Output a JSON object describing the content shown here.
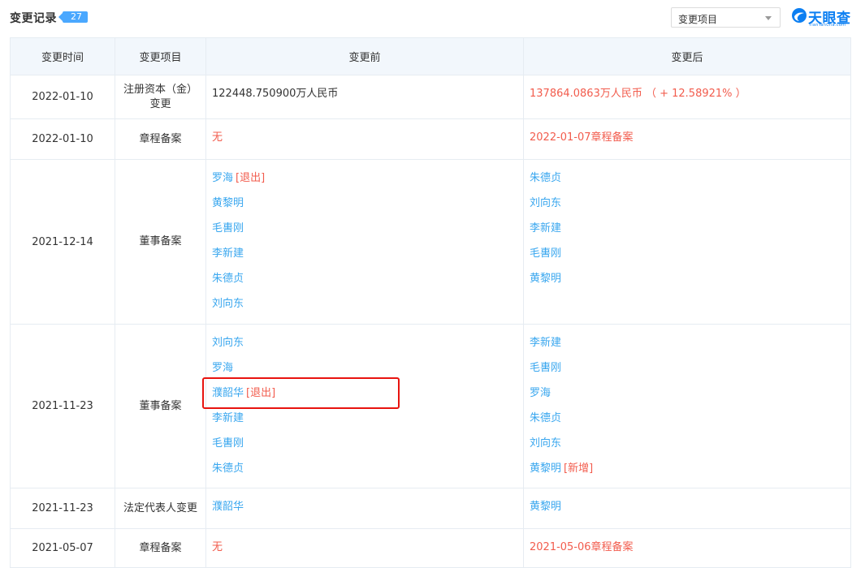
{
  "header": {
    "title": "变更记录",
    "count": "27",
    "filter": {
      "label": "变更项目"
    },
    "logo": {
      "text": "天眼查",
      "sub": "TianYanCha.com"
    }
  },
  "table": {
    "columns": [
      "变更时间",
      "变更项目",
      "变更前",
      "变更后"
    ],
    "rows": [
      {
        "time": "2022-01-10",
        "item": "注册资本（金）变更",
        "before": [
          {
            "text": "122448.750900万人民币",
            "style": "txt"
          }
        ],
        "after": [
          {
            "text": "137864.0863万人民币 （ + 12.58921% ）",
            "style": "red"
          }
        ]
      },
      {
        "time": "2022-01-10",
        "item": "章程备案",
        "before": [
          {
            "text": "无",
            "style": "red"
          }
        ],
        "after": [
          {
            "text": "2022-01-07章程备案",
            "style": "red"
          }
        ]
      },
      {
        "time": "2021-12-14",
        "item": "董事备案",
        "before": [
          {
            "text": "罗海",
            "style": "blue",
            "tag": "[退出]"
          },
          {
            "text": "黄黎明",
            "style": "blue"
          },
          {
            "text": "毛軎刚",
            "style": "blue"
          },
          {
            "text": "李新建",
            "style": "blue"
          },
          {
            "text": "朱德贞",
            "style": "blue"
          },
          {
            "text": "刘向东",
            "style": "blue"
          }
        ],
        "after": [
          {
            "text": "朱德贞",
            "style": "blue"
          },
          {
            "text": "刘向东",
            "style": "blue"
          },
          {
            "text": "李新建",
            "style": "blue"
          },
          {
            "text": "毛軎刚",
            "style": "blue"
          },
          {
            "text": "黄黎明",
            "style": "blue"
          }
        ]
      },
      {
        "time": "2021-11-23",
        "item": "董事备案",
        "before": [
          {
            "text": "刘向东",
            "style": "blue"
          },
          {
            "text": "罗海",
            "style": "blue"
          },
          {
            "text": "濮韶华",
            "style": "blue",
            "tag": "[退出]"
          },
          {
            "text": "李新建",
            "style": "blue"
          },
          {
            "text": "毛軎刚",
            "style": "blue"
          },
          {
            "text": "朱德贞",
            "style": "blue"
          }
        ],
        "after": [
          {
            "text": "李新建",
            "style": "blue"
          },
          {
            "text": "毛軎刚",
            "style": "blue"
          },
          {
            "text": "罗海",
            "style": "blue"
          },
          {
            "text": "朱德贞",
            "style": "blue"
          },
          {
            "text": "刘向东",
            "style": "blue"
          },
          {
            "text": "黄黎明",
            "style": "blue",
            "tag": "[新增]"
          }
        ]
      },
      {
        "time": "2021-11-23",
        "item": "法定代表人变更",
        "before": [
          {
            "text": "濮韶华",
            "style": "blue"
          }
        ],
        "after": [
          {
            "text": "黄黎明",
            "style": "blue"
          }
        ]
      },
      {
        "time": "2021-05-07",
        "item": "章程备案",
        "before": [
          {
            "text": "无",
            "style": "red"
          }
        ],
        "after": [
          {
            "text": "2021-05-06章程备案",
            "style": "red"
          }
        ]
      }
    ]
  },
  "colors": {
    "accent": "#4aa8ff",
    "link": "#3aa7ef",
    "highlight_text": "#f25c4d",
    "header_bg": "#f2f7fc",
    "annotation_box": "#e8140f"
  }
}
